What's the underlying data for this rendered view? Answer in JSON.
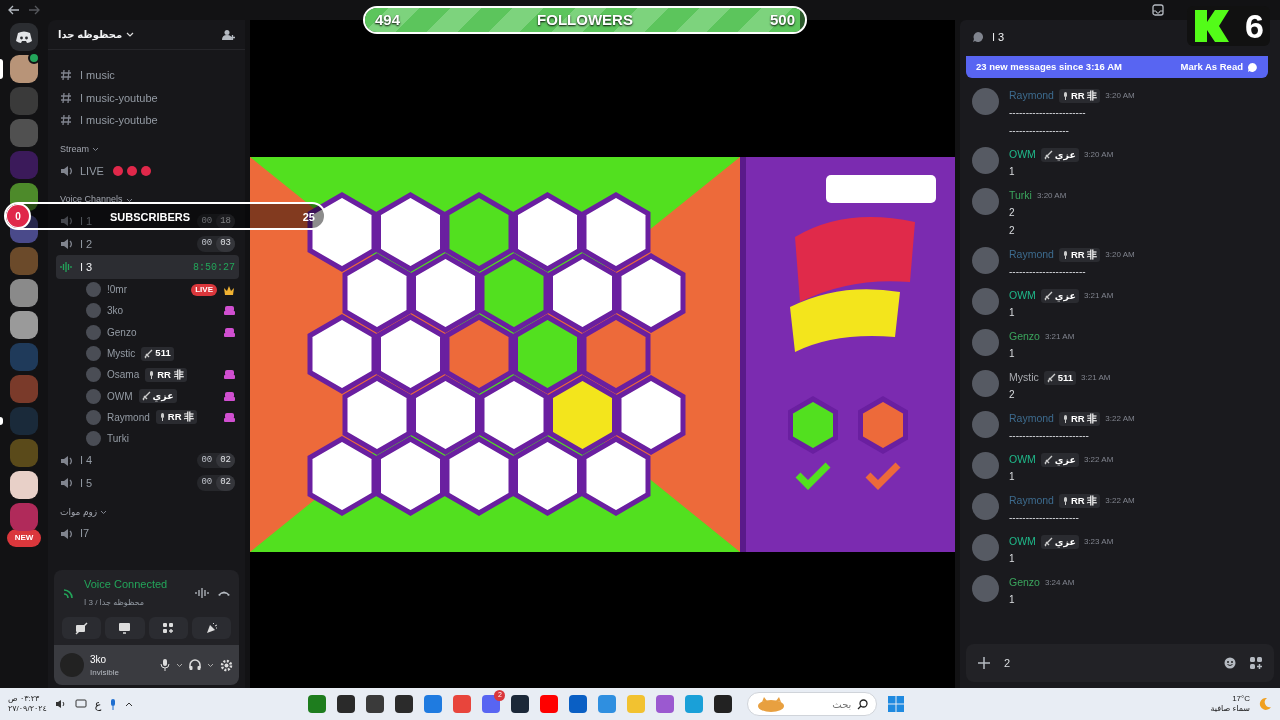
{
  "overlay": {
    "followers": {
      "current": "494",
      "label": "FOLLOWERS",
      "goal": "500",
      "level": 0.988
    },
    "subscribers": {
      "current": "0",
      "label": "SUBSCRIBERS",
      "goal": "25",
      "level": 0
    },
    "logo_number": "6"
  },
  "servers": [
    {
      "selected": true,
      "unread": false,
      "voice": true
    },
    {
      "selected": false,
      "unread": false,
      "voice": false
    },
    {
      "selected": false,
      "unread": false,
      "voice": false
    },
    {
      "selected": false,
      "unread": false,
      "voice": false
    },
    {
      "selected": false,
      "unread": false,
      "voice": false
    },
    {
      "selected": false,
      "unread": false,
      "voice": false
    },
    {
      "selected": false,
      "unread": false,
      "voice": false
    },
    {
      "selected": false,
      "unread": false,
      "voice": false
    },
    {
      "selected": false,
      "unread": false,
      "voice": false
    },
    {
      "selected": false,
      "unread": false,
      "voice": false
    },
    {
      "selected": false,
      "unread": false,
      "voice": false
    },
    {
      "selected": false,
      "unread": true,
      "voice": false
    },
    {
      "selected": false,
      "unread": false,
      "voice": false
    },
    {
      "selected": false,
      "unread": false,
      "voice": false
    },
    {
      "selected": false,
      "unread": false,
      "voice": false
    }
  ],
  "new_badge": "NEW",
  "sidebar": {
    "server_name": "محظوظه جدا",
    "items": [
      {
        "kind": "text",
        "name": "ا music"
      },
      {
        "kind": "text",
        "name": "ا music-youtube"
      },
      {
        "kind": "text",
        "name": "ا music-youtube"
      },
      {
        "kind": "category",
        "name": "Stream"
      },
      {
        "kind": "live",
        "name": "LIVE"
      },
      {
        "kind": "category",
        "name": "Voice Channels"
      },
      {
        "kind": "voice",
        "name": "ا 1",
        "selected": false,
        "timer": [
          "00",
          "18"
        ]
      },
      {
        "kind": "voice",
        "name": "ا 2",
        "selected": false,
        "timer": [
          "00",
          "03"
        ]
      },
      {
        "kind": "voice",
        "name": "ا 3",
        "selected": true,
        "duration": "8:50:27",
        "children": [
          {
            "name": "!0mr",
            "live": true,
            "live_badge": "LIVE",
            "owner": true,
            "activity": false
          },
          {
            "name": "3ko",
            "live": false,
            "owner": false,
            "activity": true
          },
          {
            "name": "Genzo",
            "live": false,
            "owner": false,
            "activity": true
          },
          {
            "name": "Mystic",
            "live": false,
            "owner": false,
            "activity": false,
            "tag": {
              "kind": "sword",
              "text": "511"
            }
          },
          {
            "name": "Osama",
            "live": false,
            "owner": false,
            "activity": true,
            "tag": {
              "kind": "mic",
              "text": "RR 非"
            }
          },
          {
            "name": "OWM",
            "live": false,
            "owner": false,
            "activity": true,
            "tag": {
              "kind": "sword",
              "text": "عزي"
            }
          },
          {
            "name": "Raymond",
            "live": false,
            "owner": false,
            "activity": true,
            "tag": {
              "kind": "mic",
              "text": "RR 非"
            }
          },
          {
            "name": "Turki",
            "live": false,
            "owner": false,
            "activity": false
          }
        ]
      },
      {
        "kind": "voice",
        "name": "ا 4",
        "selected": false,
        "timer": [
          "00",
          "02"
        ]
      },
      {
        "kind": "voice",
        "name": "ا 5",
        "selected": false,
        "timer": [
          "00",
          "02"
        ]
      },
      {
        "kind": "category",
        "name": "زوم موات"
      },
      {
        "kind": "voice",
        "name": "ا7",
        "selected": false
      }
    ],
    "voice_panel": {
      "status": "Voice Connected",
      "location": "محظوظه جدا / 3 ا"
    },
    "user": {
      "name": "3ko",
      "status": "Invisible"
    }
  },
  "chat": {
    "channel": "ا 3",
    "banner": {
      "text": "23 new messages since 3:16 AM",
      "action": "Mark As Read"
    },
    "messages": [
      {
        "author": "Raymond",
        "color": "#3d6b8e",
        "tag": {
          "kind": "mic",
          "text": "RR 非"
        },
        "time": "3:20 AM",
        "lines": [
          "-----------------------",
          "------------------"
        ]
      },
      {
        "author": "OWM",
        "color": "#1fb98a",
        "tag": {
          "kind": "sword",
          "text": "عزي"
        },
        "time": "3:20 AM",
        "lines": [
          "1"
        ]
      },
      {
        "author": "Turki",
        "color": "#3ba55d",
        "time": "3:20 AM",
        "lines": [
          "2",
          "2"
        ]
      },
      {
        "author": "Raymond",
        "color": "#3d6b8e",
        "tag": {
          "kind": "mic",
          "text": "RR 非"
        },
        "time": "3:20 AM",
        "lines": [
          "-----------------------"
        ]
      },
      {
        "author": "OWM",
        "color": "#1fb98a",
        "tag": {
          "kind": "sword",
          "text": "عزي"
        },
        "time": "3:21 AM",
        "lines": [
          "1"
        ]
      },
      {
        "author": "Genzo",
        "color": "#3ba55d",
        "time": "3:21 AM",
        "lines": [
          "1"
        ]
      },
      {
        "author": "Mystic",
        "color": "#a9abb0",
        "tag": {
          "kind": "sword",
          "text": "511"
        },
        "time": "3:21 AM",
        "lines": [
          "2"
        ]
      },
      {
        "author": "Raymond",
        "color": "#3d6b8e",
        "tag": {
          "kind": "mic",
          "text": "RR 非"
        },
        "time": "3:22 AM",
        "lines": [
          "------------------------"
        ]
      },
      {
        "author": "OWM",
        "color": "#1fb98a",
        "tag": {
          "kind": "sword",
          "text": "عزي"
        },
        "time": "3:22 AM",
        "lines": [
          "1"
        ]
      },
      {
        "author": "Raymond",
        "color": "#3d6b8e",
        "tag": {
          "kind": "mic",
          "text": "RR 非"
        },
        "time": "3:22 AM",
        "lines": [
          "---------------------"
        ]
      },
      {
        "author": "OWM",
        "color": "#1fb98a",
        "tag": {
          "kind": "sword",
          "text": "عزي"
        },
        "time": "3:23 AM",
        "lines": [
          "1"
        ]
      },
      {
        "author": "Genzo",
        "color": "#3ba55d",
        "time": "3:24 AM",
        "lines": [
          "1"
        ]
      }
    ],
    "composer": {
      "value": "2"
    }
  },
  "taskbar": {
    "clock": {
      "time": "٠٣:٢٣ ص",
      "date": "٢٧/٠٩/٢٠٢٤"
    },
    "language": "ع",
    "apps": [
      {
        "color": "#1e7d1e"
      },
      {
        "color": "#2a2a2a"
      },
      {
        "color": "#3a3a3a"
      },
      {
        "color": "#2b2b2b"
      },
      {
        "color": "#1f7be0"
      },
      {
        "color": "#e8453c"
      },
      {
        "color": "#5865f2",
        "badge": "2"
      },
      {
        "color": "#1b2838"
      },
      {
        "color": "#ff0000"
      },
      {
        "color": "#0a5fc4"
      },
      {
        "color": "#2f8fe0"
      },
      {
        "color": "#f2c230"
      },
      {
        "color": "#9b59d0"
      },
      {
        "color": "#1aa0d8"
      },
      {
        "color": "#222222"
      }
    ],
    "search": {
      "placeholder": "بحث"
    },
    "weather": {
      "temp": "17°C",
      "condition": "سماء صافية"
    }
  }
}
